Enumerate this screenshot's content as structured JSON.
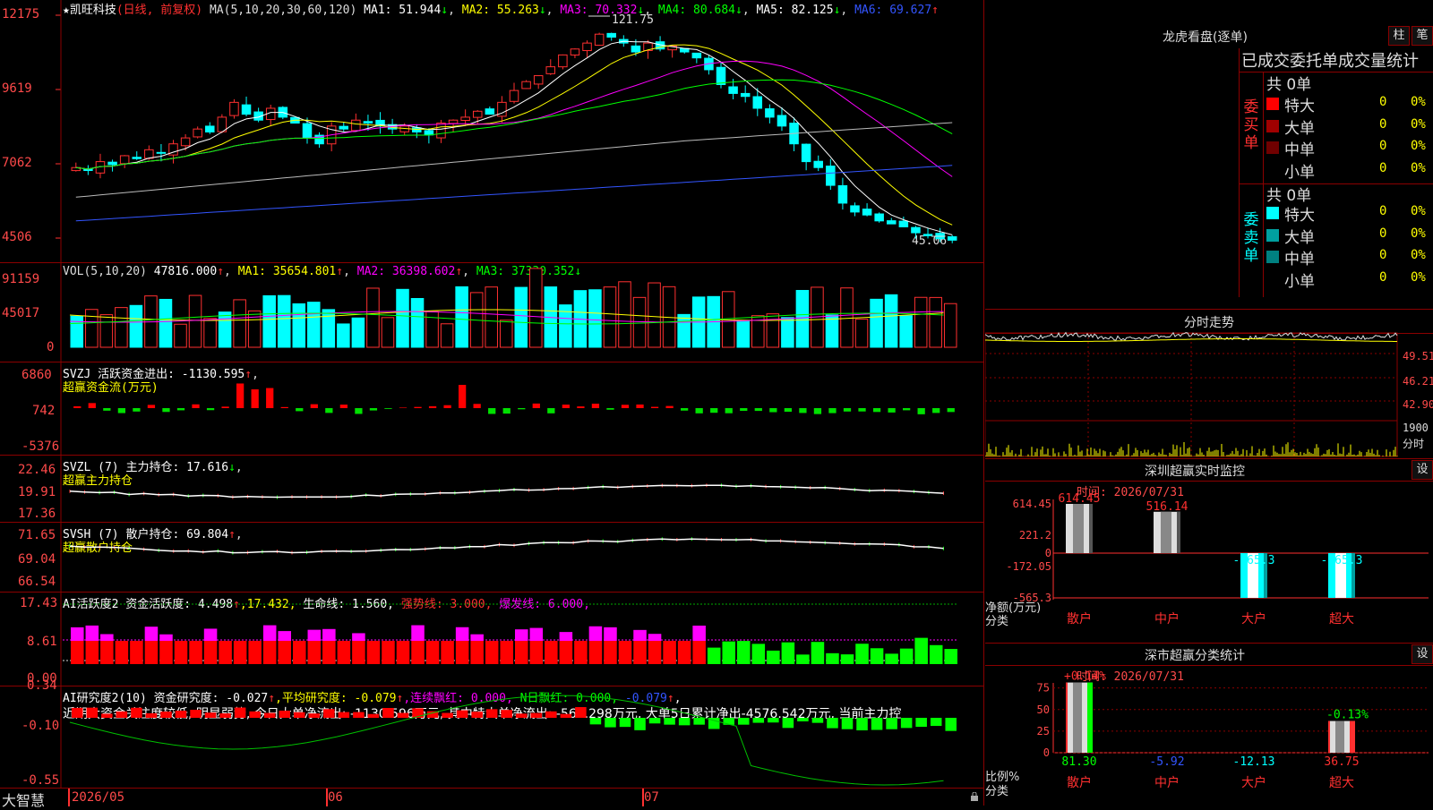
{
  "main": {
    "stock_name": "★凯旺科技",
    "period": "(日线, 前复权)",
    "ma_label": "MA(5,10,20,30,60,120)",
    "ma": [
      {
        "label": "MA1: 51.944",
        "arrow": "↓",
        "color": "#ffffff"
      },
      {
        "label": "MA2: 55.263",
        "arrow": "↓",
        "color": "#ffff00"
      },
      {
        "label": "MA3: 70.332",
        "arrow": "↓",
        "color": "#ff00ff"
      },
      {
        "label": "MA4: 80.684",
        "arrow": "↓",
        "color": "#00ff00"
      },
      {
        "label": "MA5: 82.125",
        "arrow": "↓",
        "color": "#ffffff"
      },
      {
        "label": "MA6: 69.627",
        "arrow": "↑",
        "color": "#3355ff"
      }
    ],
    "y_ticks": [
      "12175",
      "9619",
      "7062",
      "4506"
    ],
    "high_label": "121.75",
    "low_label": "45.06"
  },
  "vol": {
    "header_name": "VOL(5,10,20)",
    "value": "47816.000",
    "value_arrow": "↑",
    "ma1": "MA1: 35654.801",
    "ma1_arrow": "↑",
    "ma2": "MA2: 36398.602",
    "ma2_arrow": "↑",
    "ma3": "MA3: 37330.352",
    "ma3_arrow": "↓",
    "y_ticks": [
      "91159",
      "45017",
      "0"
    ]
  },
  "svzj": {
    "header": "SVZJ  活跃资金进出: -1130.595",
    "header_arrow": "↑",
    "subtitle": "超赢资金流(万元)",
    "y_ticks": [
      "6860",
      "742",
      "-5376"
    ]
  },
  "svzl": {
    "header": "SVZL (7) 主力持仓: 17.616",
    "header_arrow": "↓",
    "subtitle": "超赢主力持仓",
    "y_ticks": [
      "22.46",
      "19.91",
      "17.36"
    ]
  },
  "svsh": {
    "header": "SVSH (7) 散户持仓: 69.804",
    "header_arrow": "↑",
    "subtitle": "超赢散户持仓",
    "y_ticks": [
      "71.65",
      "69.04",
      "66.54"
    ]
  },
  "ai1": {
    "header": "AI活跃度2 资金活跃度: 4.498",
    "a1": "↑",
    "v2": ",17.432,",
    "v3": "生命线: 1.560,",
    "v4": "强势线: 3.000,",
    "v5": "爆发线: 6.000,",
    "y_ticks": [
      "17.43",
      "8.61",
      "0.00"
    ]
  },
  "ai2": {
    "h1": "AI研究度2(10) 资金研究度: -0.027",
    "h1a": "↑",
    "h2": ",平均研究度: -0.079",
    "h2a": "↑",
    "h3": ",连续飘红: 0.000,",
    "h4": "N日飘红: 0.000,",
    "h5": "-0.079",
    "h5a": "↑",
    "h6": ",",
    "comment": "近期大资金关注度较低, 明显弱势, 今日大单净流出: -1130.596万元, 其中特大单净流出: -565.298万元, 大单5日累计净出-4576.542万元, 当前主力控",
    "y_ticks": [
      "0.34",
      "-0.10",
      "-0.55"
    ]
  },
  "bottom": {
    "brand": "大智慧",
    "dates": [
      "2026/05",
      "06",
      "07"
    ]
  },
  "dragon": {
    "title": "龙虎看盘(逐单)",
    "btn1": "柱",
    "btn2": "笔",
    "subtitle": "已成交委托单成交量统计",
    "buy": {
      "label_chars": [
        "委",
        "买",
        "单"
      ],
      "total": "共 0单",
      "rows": [
        {
          "name": "特大",
          "count": "0",
          "pct": "0%",
          "color": "#ff0000"
        },
        {
          "name": "大单",
          "count": "0",
          "pct": "0%",
          "color": "#a00000"
        },
        {
          "name": "中单",
          "count": "0",
          "pct": "0%",
          "color": "#700000"
        },
        {
          "name": "小单",
          "count": "0",
          "pct": "0%",
          "color": "#000000"
        }
      ]
    },
    "sell": {
      "label_chars": [
        "委",
        "卖",
        "单"
      ],
      "total": "共 0单",
      "rows": [
        {
          "name": "特大",
          "count": "0",
          "pct": "0%",
          "color": "#00ffff"
        },
        {
          "name": "大单",
          "count": "0",
          "pct": "0%",
          "color": "#00a0a0"
        },
        {
          "name": "中单",
          "count": "0",
          "pct": "0%",
          "color": "#008080"
        },
        {
          "name": "小单",
          "count": "0",
          "pct": "0%",
          "color": "#000000"
        }
      ]
    }
  },
  "fenshi": {
    "title": "分时走势",
    "y_ticks": [
      "49.51",
      "46.21",
      "42.90"
    ],
    "vol_tick": "1900",
    "vol_label": "分时"
  },
  "monitor": {
    "title": "深圳超赢实时监控",
    "set_btn": "设",
    "time": "时间: 2026/07/31",
    "y_ticks": [
      "614.45",
      "221.2",
      "0",
      "-172.05",
      "-565.3"
    ],
    "y_label": "净额(万元)",
    "class_label": "分类",
    "categories": [
      "散户",
      "中户",
      "大户",
      "超大"
    ],
    "values": [
      614.45,
      516.14,
      -565.3,
      -565.3
    ],
    "value_labels": [
      "614.45",
      "516.14",
      "-565.3",
      "-565.3"
    ]
  },
  "classify": {
    "title": "深市超赢分类统计",
    "set_btn": "设",
    "time": "时间: 2026/07/31",
    "y_ticks": [
      "75",
      "50",
      "25",
      "0"
    ],
    "ratio_label": "比例%",
    "class_label": "分类",
    "categories": [
      "散户",
      "中户",
      "大户",
      "超大"
    ],
    "top_labels": [
      "+0.14%",
      "",
      "",
      "-0.13%"
    ],
    "bottom_values": [
      "81.30",
      "-5.92",
      "-12.13",
      "36.75"
    ],
    "heights": [
      81.3,
      0,
      0,
      36.75
    ]
  }
}
